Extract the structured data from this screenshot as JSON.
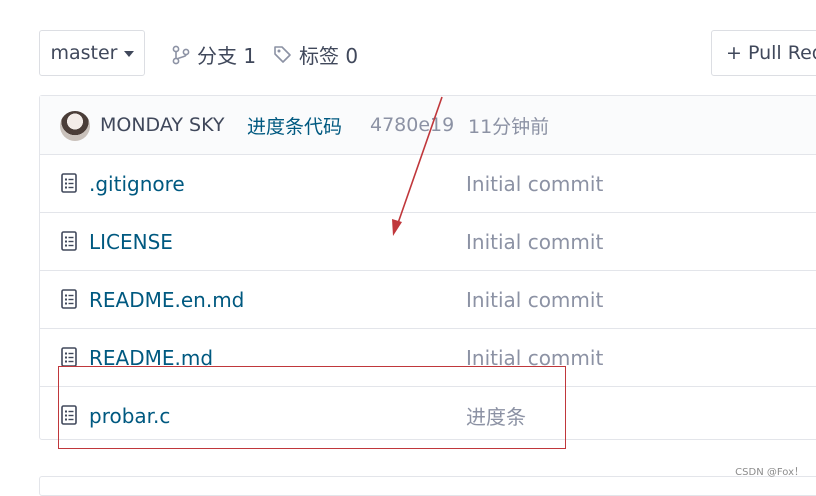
{
  "toolbar": {
    "branch_label": "master",
    "branches_stat": "分支 1",
    "tags_stat": "标签 0",
    "pull_request_label": "+ Pull Request"
  },
  "latest_commit": {
    "author": "MONDAY SKY",
    "message": "进度条代码",
    "sha": "4780e19",
    "time": "11分钟前"
  },
  "files": [
    {
      "name": ".gitignore",
      "commit": "Initial commit"
    },
    {
      "name": "LICENSE",
      "commit": "Initial commit"
    },
    {
      "name": "README.en.md",
      "commit": "Initial commit"
    },
    {
      "name": "README.md",
      "commit": "Initial commit"
    },
    {
      "name": "probar.c",
      "commit": "进度条"
    }
  ],
  "watermark": "CSDN @Fox！",
  "colors": {
    "link": "#005980",
    "muted": "#8c92a4",
    "annotation_red": "#c0373b"
  }
}
